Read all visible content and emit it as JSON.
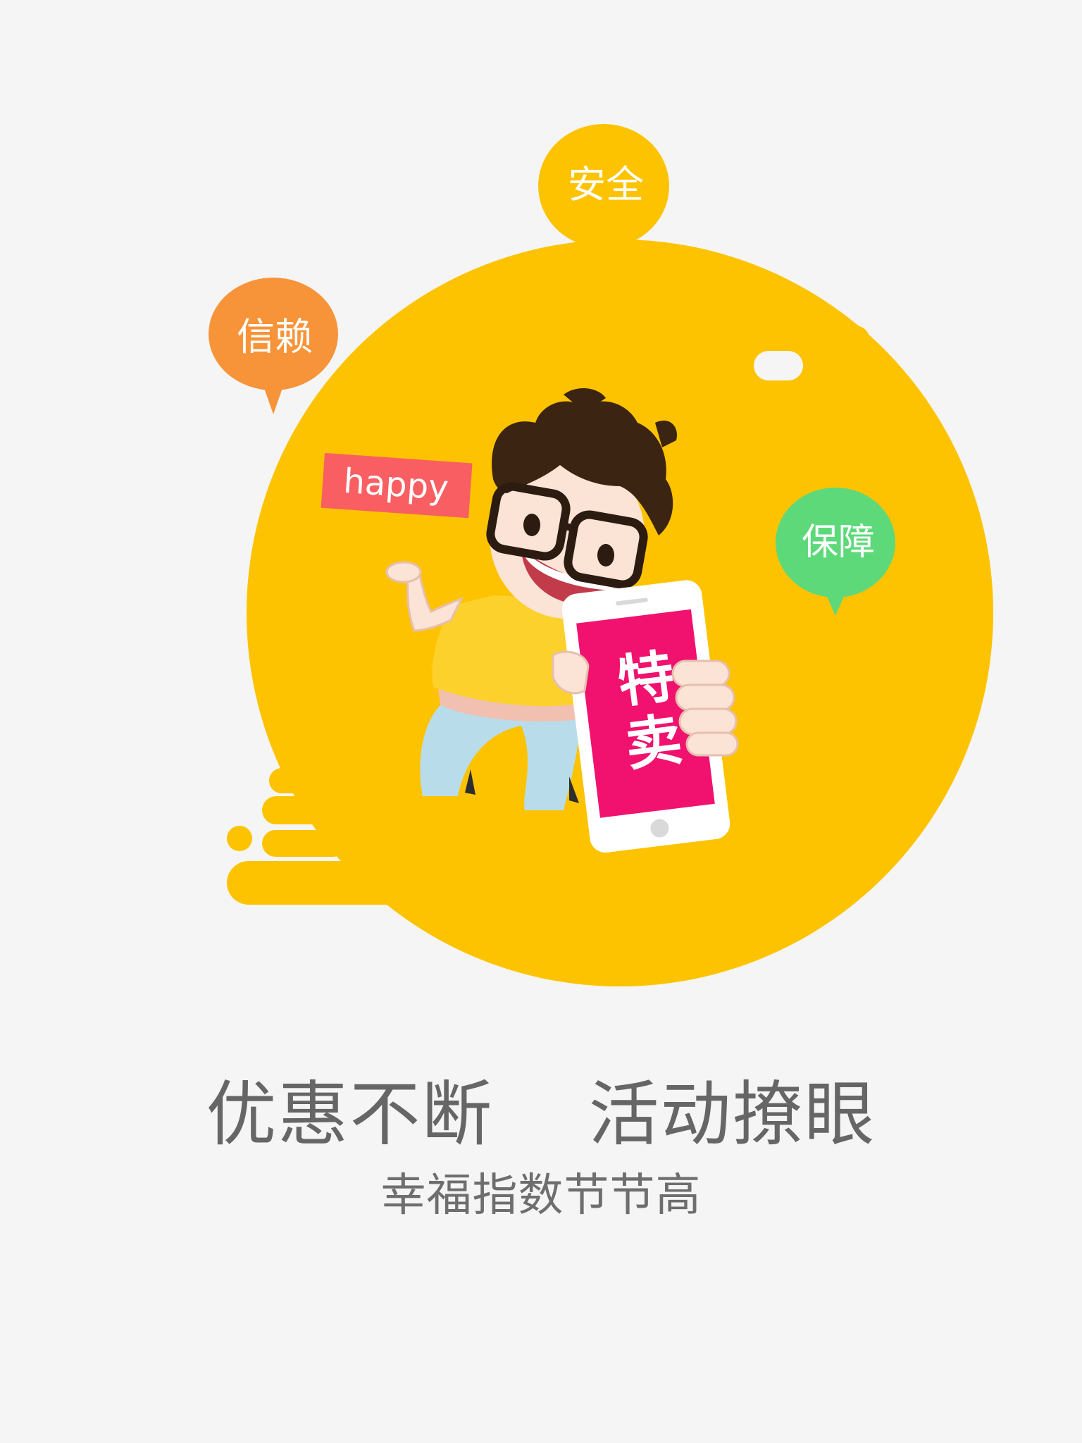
{
  "bubbles": {
    "trust": {
      "label": "信赖",
      "color": "#f7943a"
    },
    "safety": {
      "label": "安全",
      "color": "#fdc300"
    },
    "guarantee": {
      "label": "保障",
      "color": "#5ed97a"
    }
  },
  "tag": {
    "label": "happy",
    "color": "#f95f62"
  },
  "phone": {
    "screen_text": "特卖",
    "screen_color": "#f0126e"
  },
  "headline": "优惠不断    活动撩眼",
  "subline": "幸福指数节节高",
  "colors": {
    "background": "#f5f5f5",
    "blob": "#fdc300",
    "text": "#666666"
  }
}
